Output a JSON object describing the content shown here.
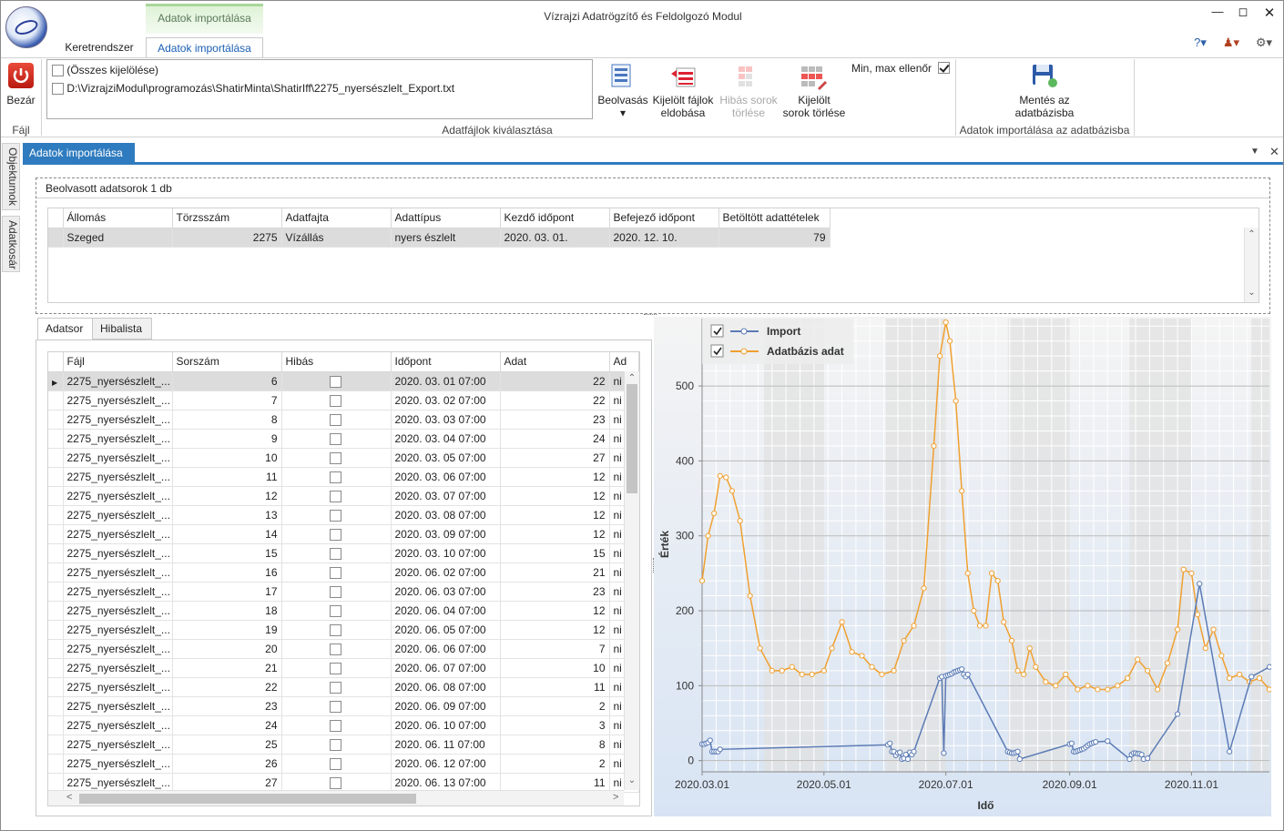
{
  "window": {
    "title": "Vízrajzi Adatrögzítő és Feldolgozó Modul"
  },
  "ribbon": {
    "context_tab": "Adatok importálása",
    "tabs": [
      {
        "label": "Keretrendszer"
      },
      {
        "label": "Adatok importálása"
      }
    ],
    "close_button": "Bezár",
    "file_group_label": "Fájl",
    "file_list": {
      "select_all": "(Összes kijelölése)",
      "files": [
        "D:\\VizrajziModul\\programozás\\ShatirMinta\\ShatirIff\\2275_nyersészlelt_Export.txt"
      ]
    },
    "file_select_group_label": "Adatfájlok kiválasztása",
    "buttons": {
      "read": "Beolvasás",
      "remove_files_1": "Kijelölt fájlok",
      "remove_files_2": "eldobása",
      "delete_bad_1": "Hibás sorok",
      "delete_bad_2": "törlése",
      "delete_selected_1": "Kijelölt",
      "delete_selected_2": "sorok törlése",
      "save_1": "Mentés az",
      "save_2": "adatbázisba"
    },
    "minmax_label": "Min, max ellenőr",
    "minmax_checked": true,
    "import_group_label": "Adatok importálása az adatbázisba"
  },
  "side_tabs": [
    "Objektumok",
    "Adatkosár"
  ],
  "document_tab": "Adatok importálása",
  "summary": {
    "caption": "Beolvasott adatsorok 1 db",
    "columns": [
      "Állomás",
      "Törzsszám",
      "Adatfajta",
      "Adattípus",
      "Kezdő időpont",
      "Befejező időpont",
      "Betöltött adattételek"
    ],
    "rows": [
      [
        "Szeged",
        "2275",
        "Vízállás",
        "nyers észlelt",
        "2020. 03. 01.",
        "2020. 12. 10.",
        "79"
      ]
    ]
  },
  "lower_tabs": [
    "Adatsor",
    "Hibalista"
  ],
  "data_grid": {
    "columns": [
      "Fájl",
      "Sorszám",
      "Hibás",
      "Időpont",
      "Adat",
      "Ad"
    ],
    "rows": [
      [
        "2275_nyersészlelt_...",
        "6",
        "2020. 03. 01 07:00",
        "22",
        "ni"
      ],
      [
        "2275_nyersészlelt_...",
        "7",
        "2020. 03. 02 07:00",
        "22",
        "ni"
      ],
      [
        "2275_nyersészlelt_...",
        "8",
        "2020. 03. 03 07:00",
        "23",
        "ni"
      ],
      [
        "2275_nyersészlelt_...",
        "9",
        "2020. 03. 04 07:00",
        "24",
        "ni"
      ],
      [
        "2275_nyersészlelt_...",
        "10",
        "2020. 03. 05 07:00",
        "27",
        "ni"
      ],
      [
        "2275_nyersészlelt_...",
        "11",
        "2020. 03. 06 07:00",
        "12",
        "ni"
      ],
      [
        "2275_nyersészlelt_...",
        "12",
        "2020. 03. 07 07:00",
        "12",
        "ni"
      ],
      [
        "2275_nyersészlelt_...",
        "13",
        "2020. 03. 08 07:00",
        "12",
        "ni"
      ],
      [
        "2275_nyersészlelt_...",
        "14",
        "2020. 03. 09 07:00",
        "12",
        "ni"
      ],
      [
        "2275_nyersészlelt_...",
        "15",
        "2020. 03. 10 07:00",
        "15",
        "ni"
      ],
      [
        "2275_nyersészlelt_...",
        "16",
        "2020. 06. 02 07:00",
        "21",
        "ni"
      ],
      [
        "2275_nyersészlelt_...",
        "17",
        "2020. 06. 03 07:00",
        "23",
        "ni"
      ],
      [
        "2275_nyersészlelt_...",
        "18",
        "2020. 06. 04 07:00",
        "12",
        "ni"
      ],
      [
        "2275_nyersészlelt_...",
        "19",
        "2020. 06. 05 07:00",
        "12",
        "ni"
      ],
      [
        "2275_nyersészlelt_...",
        "20",
        "2020. 06. 06 07:00",
        "7",
        "ni"
      ],
      [
        "2275_nyersészlelt_...",
        "21",
        "2020. 06. 07 07:00",
        "10",
        "ni"
      ],
      [
        "2275_nyersészlelt_...",
        "22",
        "2020. 06. 08 07:00",
        "11",
        "ni"
      ],
      [
        "2275_nyersészlelt_...",
        "23",
        "2020. 06. 09 07:00",
        "2",
        "ni"
      ],
      [
        "2275_nyersészlelt_...",
        "24",
        "2020. 06. 10 07:00",
        "3",
        "ni"
      ],
      [
        "2275_nyersészlelt_...",
        "25",
        "2020. 06. 11 07:00",
        "8",
        "ni"
      ],
      [
        "2275_nyersészlelt_...",
        "26",
        "2020. 06. 12 07:00",
        "2",
        "ni"
      ],
      [
        "2275_nyersészlelt_...",
        "27",
        "2020. 06. 13 07:00",
        "11",
        "ni"
      ]
    ]
  },
  "colors": {
    "import": "#5b7bb5",
    "db": "#f0a030",
    "accent": "#2f7bbf"
  },
  "chart_data": {
    "type": "line",
    "xlabel": "Idő",
    "ylabel": "Érték",
    "ylim": [
      -15,
      590
    ],
    "yticks": [
      0,
      100,
      200,
      300,
      400,
      500
    ],
    "xticks": [
      "2020.03.01",
      "2020.05.01",
      "2020.07.01",
      "2020.09.01",
      "2020.11.01"
    ],
    "legend": "top-left",
    "series": [
      {
        "name": "Import",
        "color": "#5b7bb5",
        "x": [
          "2020-03-01",
          "2020-03-02",
          "2020-03-03",
          "2020-03-04",
          "2020-03-05",
          "2020-03-06",
          "2020-03-07",
          "2020-03-08",
          "2020-03-09",
          "2020-03-10",
          "2020-06-02",
          "2020-06-03",
          "2020-06-04",
          "2020-06-05",
          "2020-06-06",
          "2020-06-07",
          "2020-06-08",
          "2020-06-09",
          "2020-06-10",
          "2020-06-11",
          "2020-06-12",
          "2020-06-13",
          "2020-06-14",
          "2020-06-15",
          "2020-06-28",
          "2020-06-29",
          "2020-06-30",
          "2020-07-01",
          "2020-07-02",
          "2020-07-03",
          "2020-07-04",
          "2020-07-05",
          "2020-07-06",
          "2020-07-07",
          "2020-07-08",
          "2020-07-09",
          "2020-07-10",
          "2020-07-11",
          "2020-07-12",
          "2020-08-01",
          "2020-08-02",
          "2020-08-03",
          "2020-08-04",
          "2020-08-05",
          "2020-08-06",
          "2020-08-07",
          "2020-09-01",
          "2020-09-02",
          "2020-09-03",
          "2020-09-04",
          "2020-09-05",
          "2020-09-06",
          "2020-09-07",
          "2020-09-08",
          "2020-09-09",
          "2020-09-10",
          "2020-09-11",
          "2020-09-12",
          "2020-09-13",
          "2020-09-14",
          "2020-09-20",
          "2020-10-01",
          "2020-10-02",
          "2020-10-03",
          "2020-10-04",
          "2020-10-05",
          "2020-10-06",
          "2020-10-07",
          "2020-10-08",
          "2020-10-10",
          "2020-10-25",
          "2020-11-05",
          "2020-11-20",
          "2020-12-01",
          "2020-12-10"
        ],
        "values": [
          22,
          22,
          23,
          24,
          27,
          12,
          12,
          12,
          12,
          15,
          21,
          23,
          12,
          12,
          7,
          10,
          11,
          2,
          3,
          8,
          2,
          11,
          8,
          12,
          110,
          112,
          10,
          113,
          114,
          115,
          116,
          118,
          119,
          120,
          121,
          122,
          115,
          112,
          115,
          12,
          11,
          10,
          10,
          11,
          12,
          2,
          22,
          23,
          12,
          12,
          13,
          14,
          15,
          16,
          18,
          20,
          22,
          23,
          24,
          25,
          26,
          2,
          8,
          10,
          10,
          9,
          9,
          8,
          2,
          3,
          62,
          236,
          12,
          112,
          125
        ]
      },
      {
        "name": "Adatbázis adat",
        "color": "#f0a030",
        "x": [
          "2020-03-01",
          "2020-03-04",
          "2020-03-07",
          "2020-03-10",
          "2020-03-13",
          "2020-03-16",
          "2020-03-20",
          "2020-03-25",
          "2020-03-30",
          "2020-04-05",
          "2020-04-10",
          "2020-04-15",
          "2020-04-20",
          "2020-04-25",
          "2020-05-01",
          "2020-05-05",
          "2020-05-10",
          "2020-05-15",
          "2020-05-20",
          "2020-05-25",
          "2020-05-30",
          "2020-06-05",
          "2020-06-10",
          "2020-06-15",
          "2020-06-20",
          "2020-06-25",
          "2020-06-28",
          "2020-07-01",
          "2020-07-03",
          "2020-07-06",
          "2020-07-09",
          "2020-07-12",
          "2020-07-15",
          "2020-07-18",
          "2020-07-21",
          "2020-07-24",
          "2020-07-27",
          "2020-07-30",
          "2020-08-03",
          "2020-08-06",
          "2020-08-09",
          "2020-08-12",
          "2020-08-15",
          "2020-08-20",
          "2020-08-25",
          "2020-08-30",
          "2020-09-05",
          "2020-09-10",
          "2020-09-15",
          "2020-09-20",
          "2020-09-25",
          "2020-09-30",
          "2020-10-05",
          "2020-10-10",
          "2020-10-15",
          "2020-10-20",
          "2020-10-25",
          "2020-10-28",
          "2020-11-01",
          "2020-11-04",
          "2020-11-08",
          "2020-11-12",
          "2020-11-16",
          "2020-11-20",
          "2020-11-25",
          "2020-11-30",
          "2020-12-05",
          "2020-12-10"
        ],
        "values": [
          240,
          300,
          330,
          380,
          378,
          360,
          320,
          220,
          150,
          120,
          120,
          125,
          115,
          115,
          120,
          150,
          185,
          145,
          140,
          125,
          115,
          120,
          160,
          180,
          230,
          420,
          540,
          585,
          560,
          480,
          360,
          250,
          200,
          180,
          180,
          250,
          240,
          185,
          160,
          120,
          115,
          150,
          125,
          105,
          100,
          115,
          95,
          100,
          95,
          95,
          100,
          110,
          135,
          120,
          95,
          130,
          175,
          255,
          250,
          195,
          150,
          175,
          140,
          110,
          115,
          105,
          110,
          95
        ]
      }
    ]
  }
}
